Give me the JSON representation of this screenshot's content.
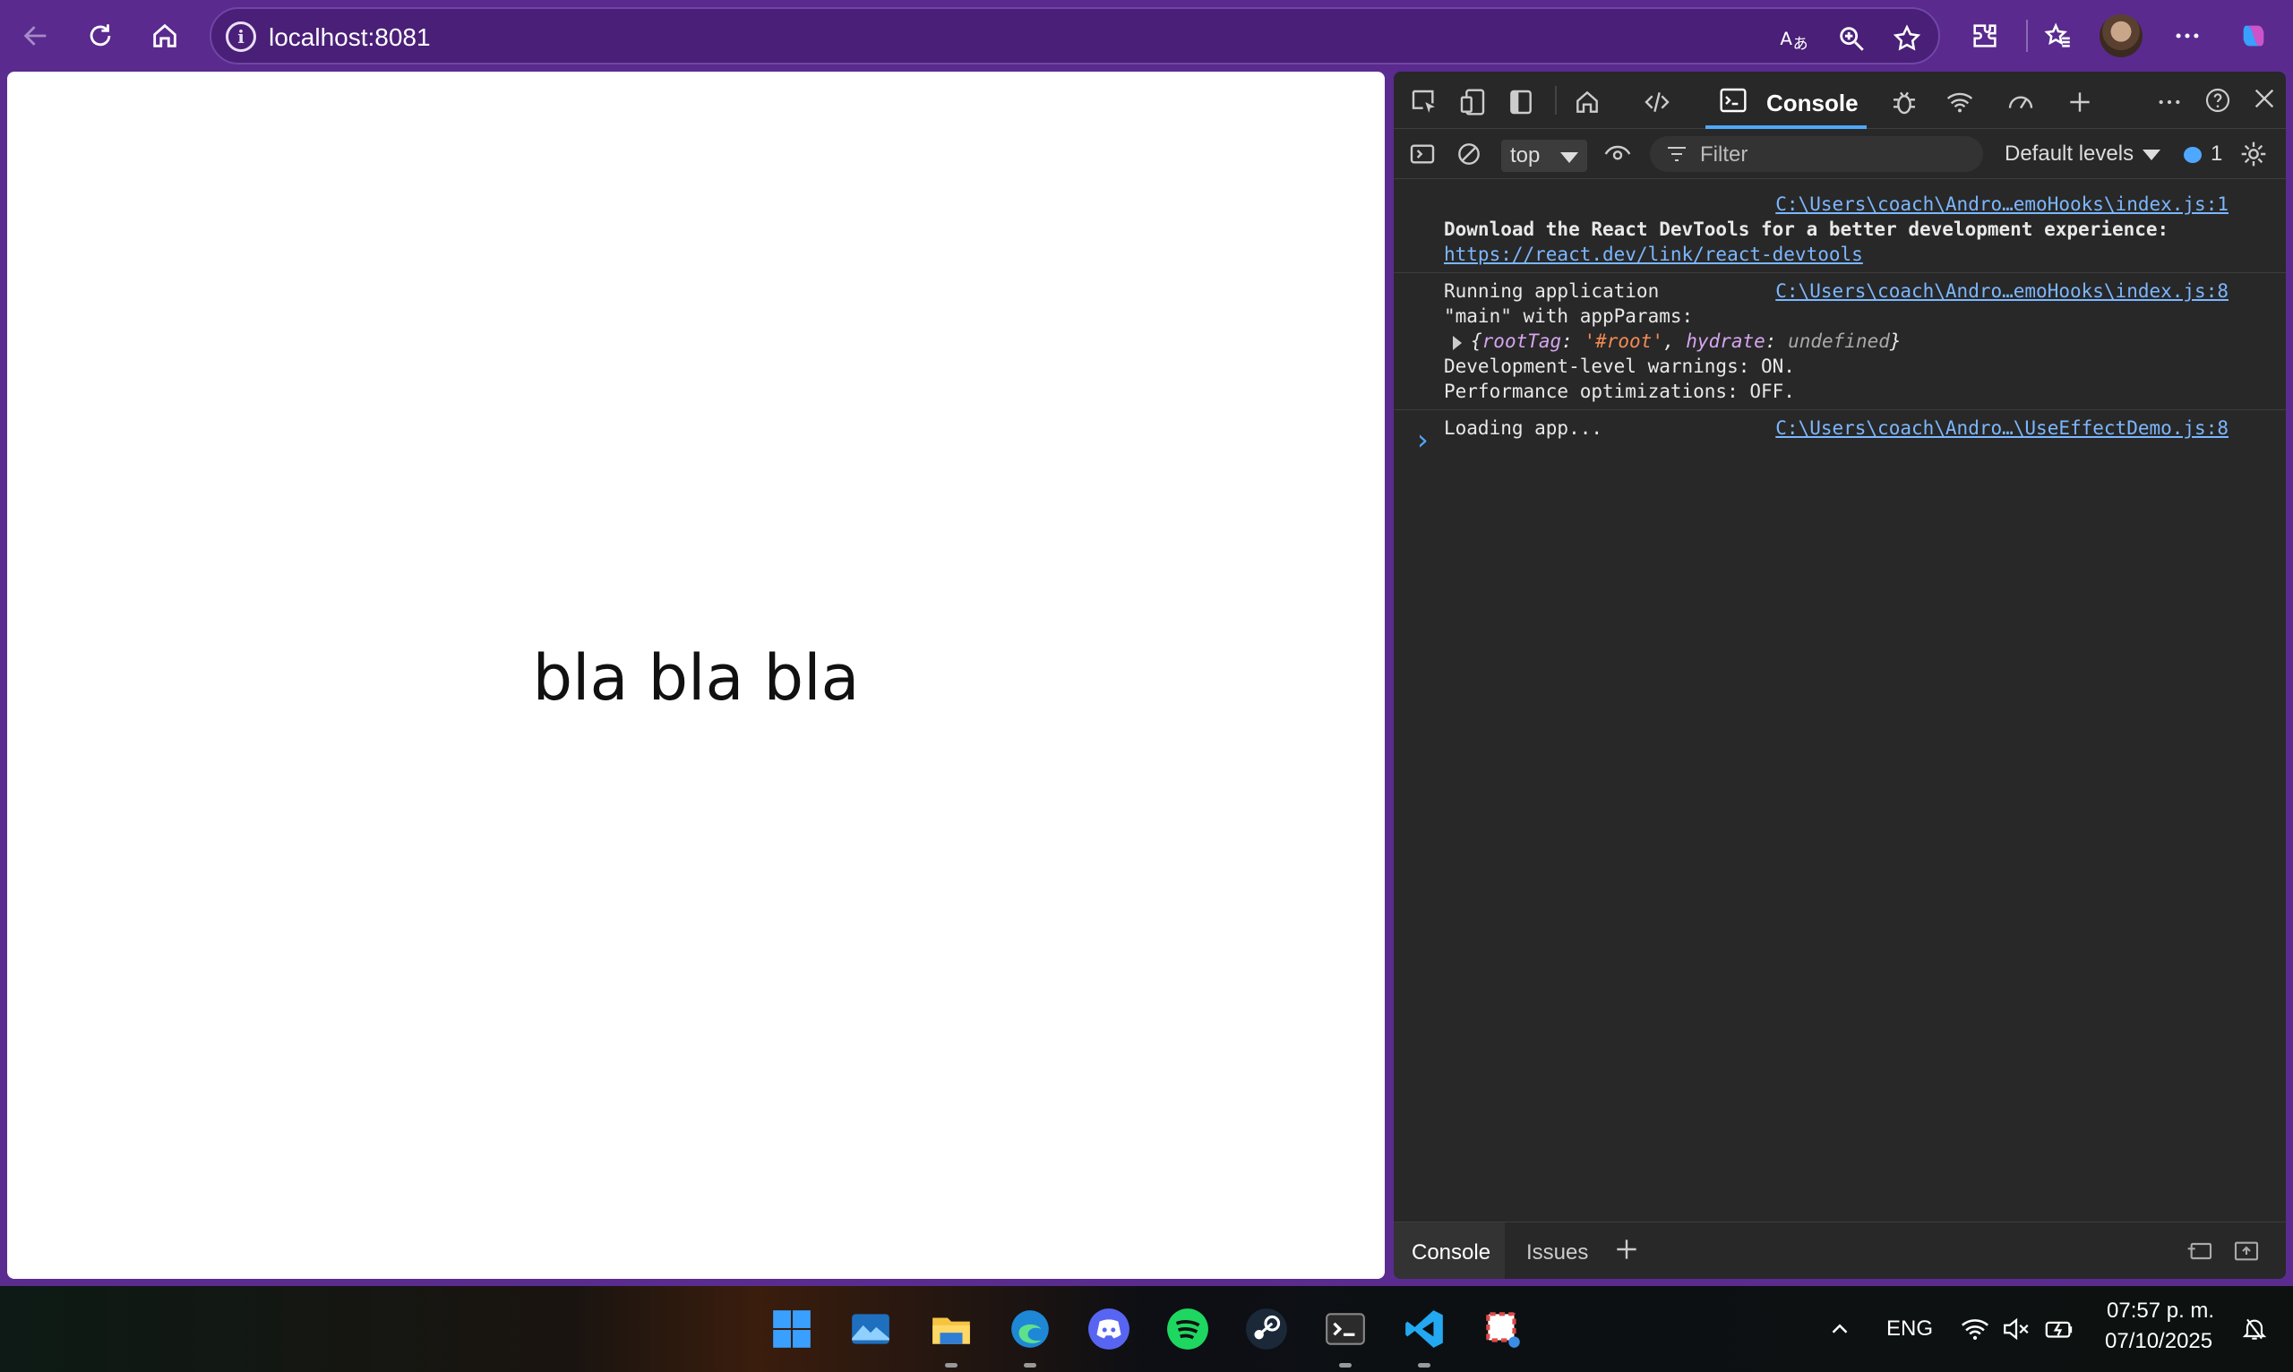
{
  "browser": {
    "url": "localhost:8081"
  },
  "page": {
    "text": "bla bla bla"
  },
  "devtools": {
    "active_tab": "Console",
    "context": "top",
    "filter_placeholder": "Filter",
    "levels": "Default levels",
    "message_count": "1",
    "messages": [
      {
        "source": "C:\\Users\\coach\\Andro…emoHooks\\index.js:1",
        "line1": "Download the React DevTools for a better development experience:",
        "link": "https://react.dev/link/react-devtools"
      },
      {
        "source": "C:\\Users\\coach\\Andro…emoHooks\\index.js:8",
        "line1": "Running application",
        "line2": "\"main\" with appParams:",
        "obj_open": "{",
        "obj_k1": "rootTag",
        "obj_v1": "'#root'",
        "obj_k2": "hydrate",
        "obj_v2": "undefined",
        "obj_close": "}",
        "line3": "Development-level warnings: ON.",
        "line4": "Performance optimizations: OFF."
      },
      {
        "source": "C:\\Users\\coach\\Andro…\\UseEffectDemo.js:8",
        "line1": "Loading app..."
      }
    ],
    "drawer_tabs": [
      "Console",
      "Issues"
    ]
  },
  "taskbar": {
    "language": "ENG",
    "time": "07:57 p. m.",
    "date": "07/10/2025"
  }
}
